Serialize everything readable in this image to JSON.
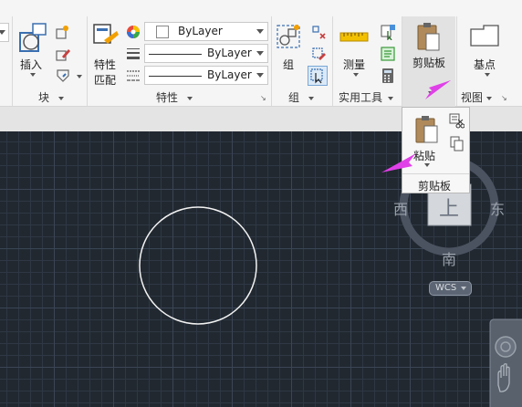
{
  "ribbon": {
    "insert_label": "插入",
    "block_panel_label": "块",
    "match_props_label_1": "特性",
    "match_props_label_2": "匹配",
    "properties_panel_label": "特性",
    "bylayer_color": "ByLayer",
    "bylayer_linetype": "ByLayer",
    "bylayer_lineweight": "ByLayer",
    "group_label": "组",
    "group_panel_label": "组",
    "measure_label": "测量",
    "utilities_panel_label": "实用工具",
    "clipboard_label": "剪贴板",
    "base_label": "基点",
    "view_panel_label": "视图"
  },
  "popup": {
    "paste_label": "粘贴",
    "panel_label": "剪贴板"
  },
  "viewcube": {
    "west": "西",
    "east": "东",
    "south": "南",
    "top_face": "上",
    "wcs": "WCS"
  },
  "colors": {
    "canvas_bg": "#212830",
    "annotation_arrow": "#e040e8",
    "ribbon_bg": "#f5f5f5"
  }
}
